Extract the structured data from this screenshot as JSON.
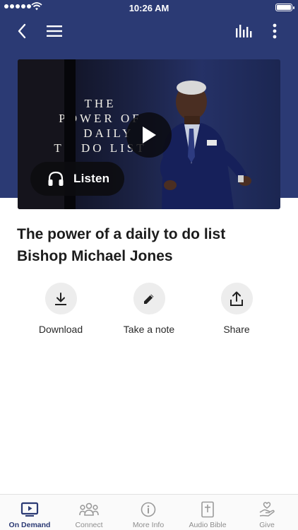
{
  "status_bar": {
    "time": "10:26 AM"
  },
  "nav": {
    "back_icon": "chevron-left-icon",
    "menu_icon": "hamburger-menu-icon",
    "audio_icon": "equalizer-bars-icon",
    "more_icon": "more-vertical-icon"
  },
  "colors": {
    "header": "#2b3a74",
    "accent": "#2b3a74",
    "action_circle": "#ededed",
    "tab_inactive": "#8e8e8e"
  },
  "video": {
    "title_lines": [
      "THE",
      "POWER OF",
      "A DAILY",
      "TO DO LIST"
    ],
    "play_icon": "play-icon",
    "listen_icon": "headphones-icon",
    "listen_label": "Listen"
  },
  "sermon": {
    "title_line1": "The power of a daily to do list",
    "title_line2": "Bishop Michael Jones"
  },
  "actions": [
    {
      "label": "Download",
      "icon": "download-icon"
    },
    {
      "label": "Take a note",
      "icon": "pencil-icon"
    },
    {
      "label": "Share",
      "icon": "share-icon"
    }
  ],
  "tabs": [
    {
      "label": "On Demand",
      "icon": "tv-play-icon",
      "active": true
    },
    {
      "label": "Connect",
      "icon": "people-group-icon",
      "active": false
    },
    {
      "label": "More Info",
      "icon": "info-icon",
      "active": false
    },
    {
      "label": "Audio Bible",
      "icon": "bible-icon",
      "active": false
    },
    {
      "label": "Give",
      "icon": "hand-heart-icon",
      "active": false
    }
  ]
}
